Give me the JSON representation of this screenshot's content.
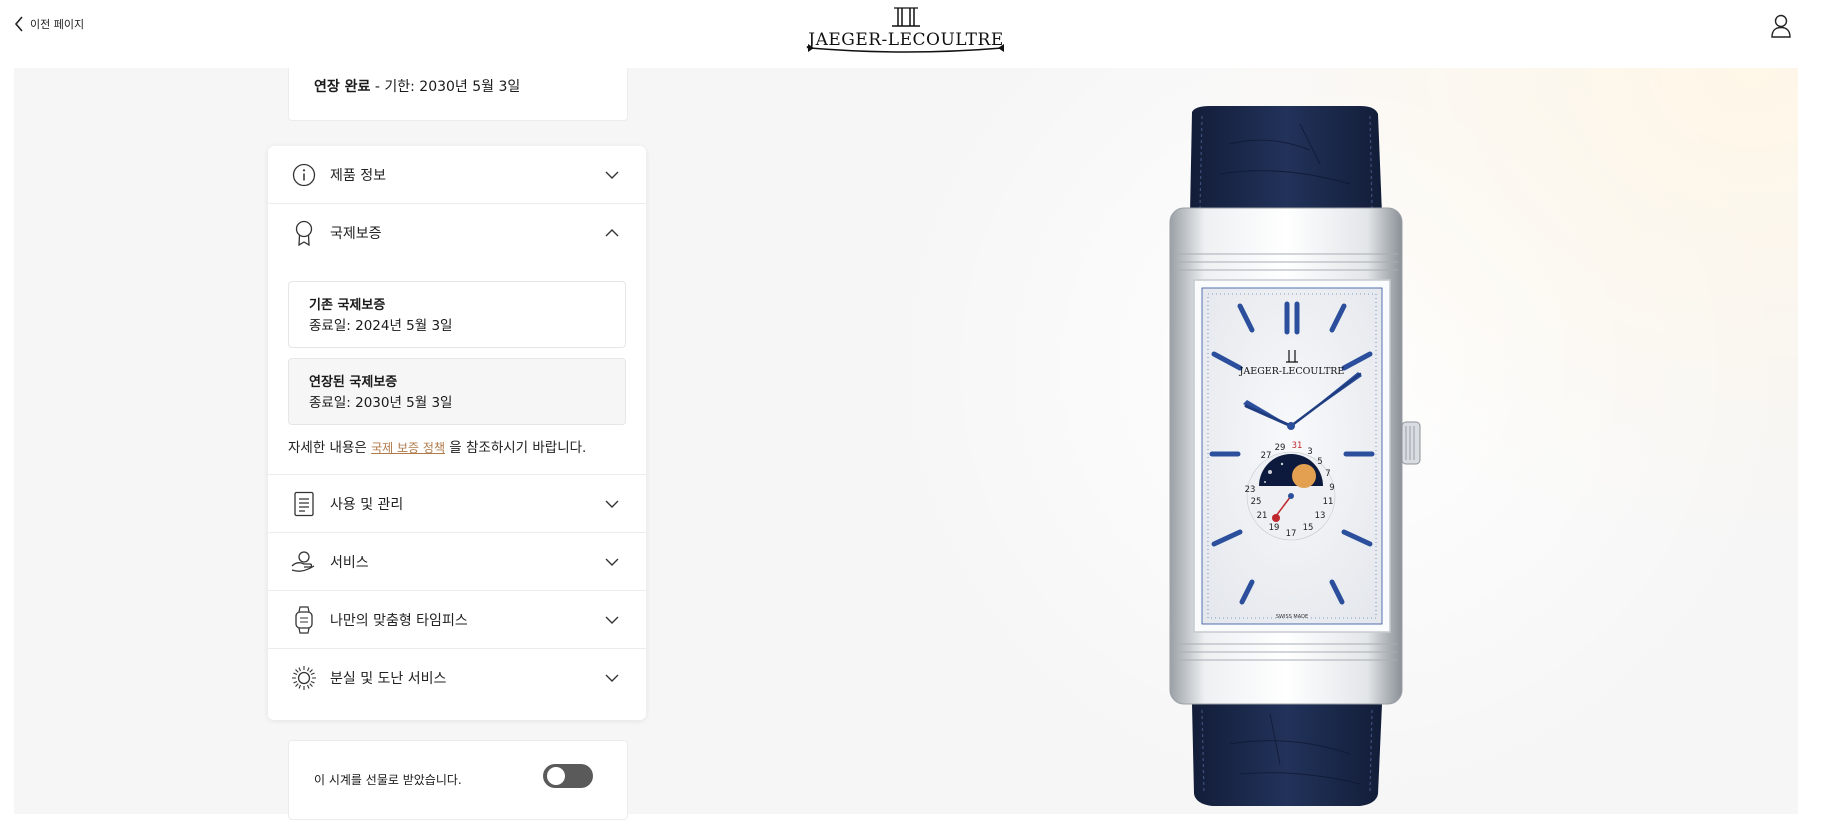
{
  "header": {
    "back_label": "이전 페이지",
    "brand": "JAEGER-LECOULTRE"
  },
  "extension": {
    "status_bold": "연장 완료",
    "status_rest": " - 기한: 2030년 5월 3일"
  },
  "accordion": {
    "items": [
      {
        "label": "제품 정보",
        "icon": "info-icon",
        "expanded": false
      },
      {
        "label": "국제보증",
        "icon": "ribbon-icon",
        "expanded": true
      },
      {
        "label": "사용 및 관리",
        "icon": "document-icon",
        "expanded": false
      },
      {
        "label": "서비스",
        "icon": "hand-service-icon",
        "expanded": false
      },
      {
        "label": "나만의 맞춤형 타임피스",
        "icon": "watch-icon",
        "expanded": false
      },
      {
        "label": "분실 및 도난 서비스",
        "icon": "sun-icon",
        "expanded": false
      }
    ],
    "warranty": {
      "original_title": "기존 국제보증",
      "original_date": "종료일: 2024년 5월 3일",
      "extended_title": "연장된 국제보증",
      "extended_date": "종료일: 2030년 5월 3일",
      "note_before": "자세한 내용은 ",
      "note_link": "국제 보증 정책",
      "note_after": " 을 참조하시기 바랍니다."
    }
  },
  "gift": {
    "label": "이 시계를 선물로 받았습니다.",
    "toggle_on": false
  },
  "watch": {
    "dial_brand": "JAEGER-LECOULTRE",
    "swiss_made": "SWISS MADE"
  },
  "colors": {
    "strap": "#1e2d52",
    "hands": "#2b4f9c",
    "link": "#b07a4a",
    "toggle": "#5a5a5a"
  }
}
